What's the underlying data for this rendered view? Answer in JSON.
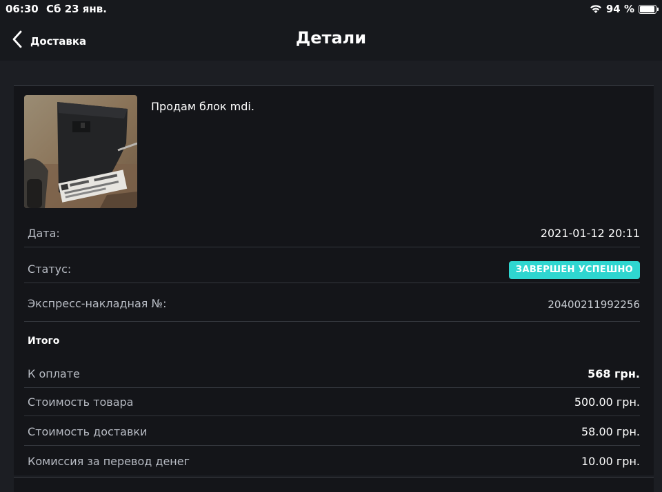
{
  "status_bar": {
    "time": "06:30",
    "date": "Сб 23 янв.",
    "battery": "94 %",
    "battery_level": 0.94
  },
  "nav": {
    "back_label": "Доставка",
    "title": "Детали"
  },
  "item": {
    "title": "Продам блок mdi."
  },
  "details": {
    "date_label": "Дата:",
    "date_value": "2021-01-12 20:11",
    "status_label": "Статус:",
    "status_value": "ЗАВЕРШЕН УСПЕШНО",
    "waybill_label": "Экспресс-накладная №:",
    "waybill_value": "20400211992256"
  },
  "totals": {
    "section_title": "Итого",
    "to_pay_label": "К оплате",
    "to_pay_value": "568 грн.",
    "goods_label": "Стоимость товара",
    "goods_value": "500.00 грн.",
    "delivery_label": "Стоимость доставки",
    "delivery_value": "58.00 грн.",
    "commission_label": "Комиссия за перевод денег",
    "commission_value": "10.00 грн."
  },
  "colors": {
    "background": "#1c1e23",
    "card": "#141519",
    "status_badge": "#2fd6d0"
  }
}
